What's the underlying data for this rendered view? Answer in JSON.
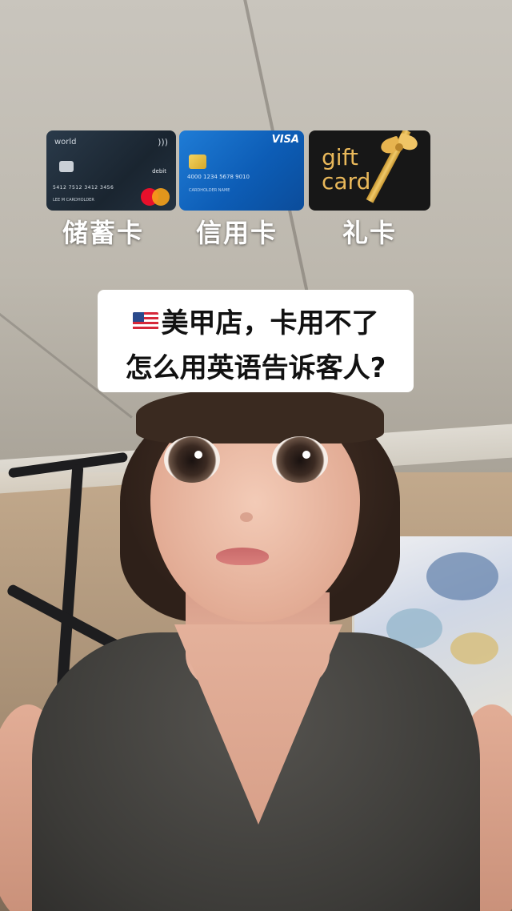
{
  "cards": [
    {
      "type": "debit",
      "label": "储蓄卡",
      "brand_text": "world",
      "kind_text": "debit",
      "number_text": "5412 7512 3412 3456",
      "holder_text": "LEE M CARDHOLDER",
      "network": "mastercard"
    },
    {
      "type": "credit",
      "label": "信用卡",
      "brand_text": "VISA",
      "number_text": "4000 1234 5678 9010",
      "holder_text": "CARDHOLDER NAME",
      "network": "visa"
    },
    {
      "type": "gift",
      "label": "礼卡",
      "line1": "gift",
      "line2": "card",
      "accent_color": "#e9b85a"
    }
  ],
  "question": {
    "flag_icon": "us-flag-icon",
    "line1": "美甲店，卡用不了",
    "line2": "怎么用英语告诉客人?"
  },
  "colors": {
    "label_text": "#ffffff",
    "question_bg": "#ffffff",
    "question_text": "#111111"
  }
}
